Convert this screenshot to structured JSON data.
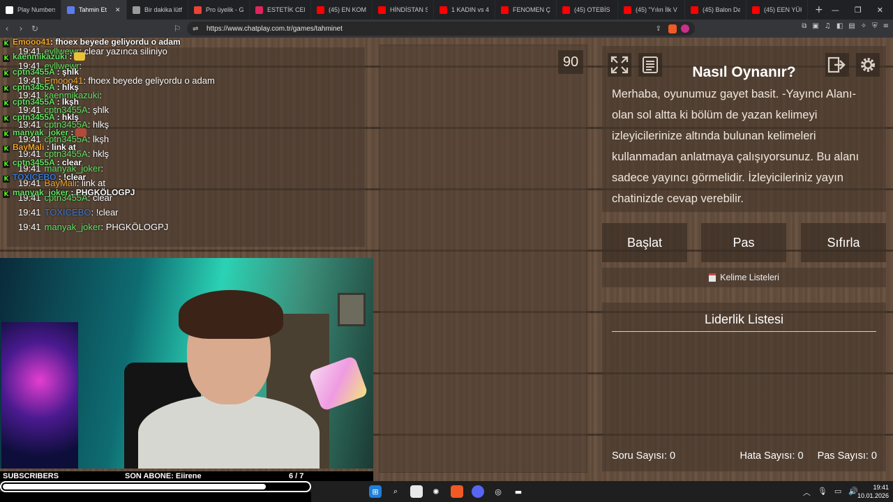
{
  "browser": {
    "tabs": [
      {
        "label": "Play Numbers |",
        "color": "#ffffff",
        "active": false
      },
      {
        "label": "Tahmin Et",
        "color": "#5a7df0",
        "active": true
      },
      {
        "label": "Bir dakika lütfe",
        "color": "#9a9a9a",
        "active": false
      },
      {
        "label": "Pro üyelik - Ge",
        "color": "#ea4335",
        "active": false
      },
      {
        "label": "ESTETİK CERRA",
        "color": "#e0245e",
        "active": false
      },
      {
        "label": "(45) EN KOMİK",
        "color": "#ff0000",
        "active": false
      },
      {
        "label": "HİNDİSTAN SO",
        "color": "#ff0000",
        "active": false
      },
      {
        "label": "1 KADIN vs 4 E",
        "color": "#ff0000",
        "active": false
      },
      {
        "label": "FENOMEN ÇİFT",
        "color": "#ff0000",
        "active": false
      },
      {
        "label": "(45) OTEBİS | M",
        "color": "#ff0000",
        "active": false
      },
      {
        "label": "(45) \"Yılın İlk V",
        "color": "#ff0000",
        "active": false
      },
      {
        "label": "(45) Balon Date",
        "color": "#ff0000",
        "active": false
      },
      {
        "label": "(45) EEN YÜKSE",
        "color": "#ff0000",
        "active": false
      }
    ],
    "new_tab": "+",
    "url": "https://www.chatplay.com.tr/games/tahminet"
  },
  "chat": {
    "overlay": [
      {
        "user": "Emooo41",
        "color": "#f2a72c",
        "text": ": fhoex beyede geliyordu o adam"
      },
      {
        "user": "kaenmikazuki",
        "color": "#63e263",
        "text": " :"
      },
      {
        "user": "cptn3455A",
        "color": "#63e263",
        "text": " : şhlk"
      },
      {
        "user": "cptn3455A",
        "color": "#63e263",
        "text": " : hlkş"
      },
      {
        "user": "cptn3455A",
        "color": "#63e263",
        "text": " : lkşh"
      },
      {
        "user": "cptn3455A",
        "color": "#63e263",
        "text": " : hklş"
      },
      {
        "user": "manyak_joker",
        "color": "#63e263",
        "text": " :"
      },
      {
        "user": "BayMali",
        "color": "#f2a72c",
        "text": " : link at"
      },
      {
        "user": "cptn3455A",
        "color": "#63e263",
        "text": " : clear"
      },
      {
        "user": "TOXICEBO",
        "color": "#3a7bd5",
        "text": " : !clear"
      },
      {
        "user": "manyak_joker",
        "color": "#63e263",
        "text": " : PHGKÖLOGPJ"
      }
    ],
    "log": [
      {
        "time": "19:41",
        "user": "evllwewr",
        "color": "#63e263",
        "text": ": clear yazınca siliniyo"
      },
      {
        "time": "19:41",
        "user": "evllwewr",
        "color": "#63e263",
        "text": ":"
      },
      {
        "time": "19:41",
        "user": "Emooo41",
        "color": "#f2a72c",
        "text": ": fhoex beyede geliyordu o adam"
      },
      {
        "time": "19:41",
        "user": "kaenmikazuki",
        "color": "#63e263",
        "text": ":"
      },
      {
        "time": "19:41",
        "user": "cptn3455A",
        "color": "#63e263",
        "text": ": şhlk"
      },
      {
        "time": "19:41",
        "user": "cptn3455A",
        "color": "#63e263",
        "text": ": hlkş"
      },
      {
        "time": "19:41",
        "user": "cptn3455A",
        "color": "#63e263",
        "text": ": lkşh"
      },
      {
        "time": "19:41",
        "user": "cptn3455A",
        "color": "#63e263",
        "text": ": hklş"
      },
      {
        "time": "19:41",
        "user": "manyak_joker",
        "color": "#63e263",
        "text": ":"
      },
      {
        "time": "19:41",
        "user": "BayMali",
        "color": "#f2a72c",
        "text": ": link at"
      },
      {
        "time": "19:41",
        "user": "cptn3455A",
        "color": "#63e263",
        "text": ": clear"
      },
      {
        "time": "19:41",
        "user": "TOXICEBO",
        "color": "#3a7bd5",
        "text": ": !clear"
      },
      {
        "time": "19:41",
        "user": "manyak_joker",
        "color": "#63e263",
        "text": ": PHGKÖLOGPJ"
      }
    ]
  },
  "game": {
    "timer": "90",
    "how_title": "Nasıl Oynanır?",
    "how_text": "Merhaba, oyunumuz gayet basit. -Yayıncı Alanı- olan sol altta ki bölüm de yazan kelimeyi izleyicilerinize altında bulunan kelimeleri kullanmadan anlatmaya çalışıyorsunuz. Bu alanı sadece yayıncı görmelidir. İzleyicileriniz yayın chatinizde cevap verebilir.",
    "buttons": {
      "start": "Başlat",
      "pass": "Pas",
      "reset": "Sıfırla"
    },
    "word_lists": "Kelime Listeleri",
    "leaderboard_title": "Liderlik Listesi",
    "stats": {
      "questions": "Soru Sayısı: 0",
      "errors": "Hata Sayısı: 0",
      "passes": "Pas Sayısı: 0"
    }
  },
  "overlay": {
    "subscribers_label": "SUBSCRIBERS",
    "last_sub": "SON ABONE: Eiirene",
    "goal": "6 / 7",
    "goal_fraction": 0.857
  },
  "taskbar": {
    "time": "19:41",
    "date": "10.01.2026"
  }
}
